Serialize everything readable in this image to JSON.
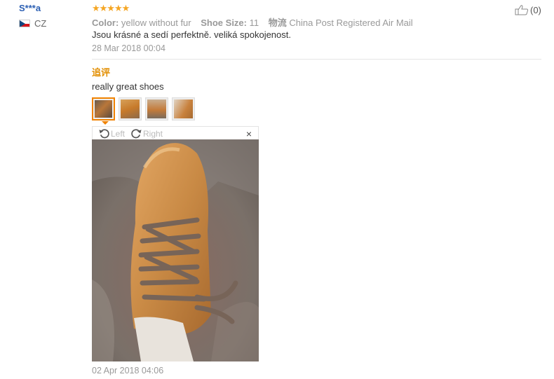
{
  "reviewer": {
    "name": "S***a",
    "country": "CZ"
  },
  "rating": "★★★★★",
  "meta": {
    "color_label": "Color:",
    "color_value": "yellow without fur",
    "size_label": "Shoe Size:",
    "size_value": "11",
    "shipping_label": "物流",
    "shipping_value": "China Post Registered Air Mail"
  },
  "review_text": "Jsou krásné a sedí perfektně. veliká spokojenost.",
  "review_date": "28 Mar 2018 00:04",
  "append": {
    "label": "追评",
    "text": "really great shoes",
    "date": "02 Apr 2018 04:06"
  },
  "viewer": {
    "rotate_left": "Left",
    "rotate_right": "Right",
    "close": "×"
  },
  "like": {
    "count": "(0)"
  },
  "colors": {
    "accent": "#f08200",
    "name": "#2b5fb3",
    "append_label": "#e28e00"
  }
}
